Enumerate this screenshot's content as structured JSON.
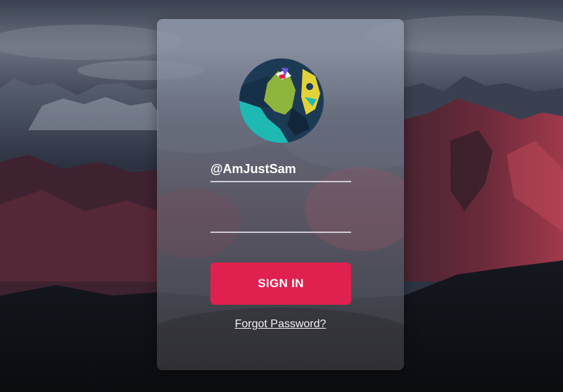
{
  "login": {
    "username_value": "@AmJustSam",
    "password_value": "",
    "signin_label": "SIGN IN",
    "forgot_label": "Forgot Password?"
  },
  "colors": {
    "accent": "#e0204f",
    "field_underline": "#e1e1e8"
  },
  "icons": {
    "avatar": "cartoon-face-avatar"
  }
}
